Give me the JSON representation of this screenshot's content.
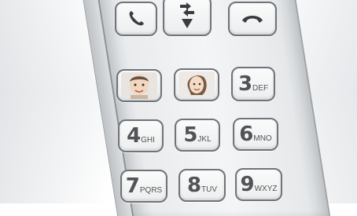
{
  "keys": {
    "key3": {
      "digit": "3",
      "letters": "DEF"
    },
    "key4": {
      "digit": "4",
      "letters": "GHI"
    },
    "key5": {
      "digit": "5",
      "letters": "JKL"
    },
    "key6": {
      "digit": "6",
      "letters": "MNO"
    },
    "key7": {
      "digit": "7",
      "letters": "PQRS"
    },
    "key8": {
      "digit": "8",
      "letters": "TUV"
    },
    "key9": {
      "digit": "9",
      "letters": "WXYZ"
    }
  },
  "icons": {
    "call": "phone-call-icon",
    "nav": "transfer-arrows-icon",
    "end": "phone-hangup-icon",
    "photo1": "boy-photo-icon",
    "photo2": "girl-photo-icon"
  },
  "colors": {
    "key_border": "#6f7478",
    "key_text": "#505457",
    "phone_body": "#eef0f1"
  }
}
